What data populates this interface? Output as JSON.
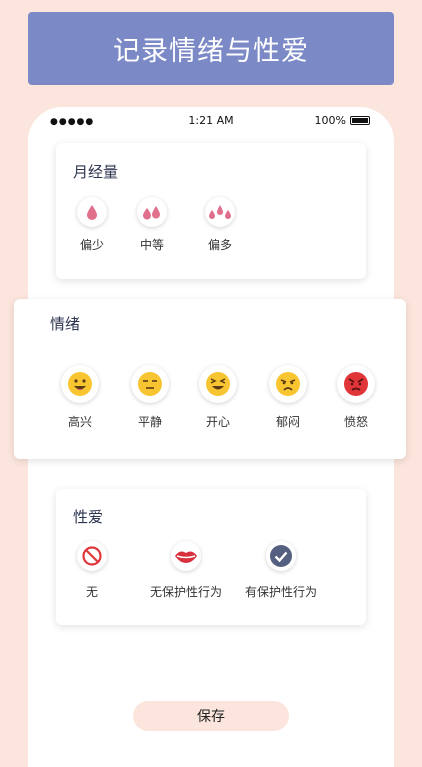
{
  "banner": {
    "title": "记录情绪与性爱"
  },
  "status_bar": {
    "time": "1:21 AM",
    "battery": "100%"
  },
  "flow": {
    "title": "月经量",
    "options": [
      {
        "label": "偏少",
        "icon": "one-drop-icon"
      },
      {
        "label": "中等",
        "icon": "two-drops-icon"
      },
      {
        "label": "偏多",
        "icon": "three-drops-icon"
      }
    ]
  },
  "mood": {
    "title": "情绪",
    "options": [
      {
        "label": "高兴",
        "icon": "happy-face-icon"
      },
      {
        "label": "平静",
        "icon": "calm-face-icon"
      },
      {
        "label": "开心",
        "icon": "laughing-face-icon"
      },
      {
        "label": "郁闷",
        "icon": "gloomy-face-icon"
      },
      {
        "label": "愤怒",
        "icon": "angry-face-icon"
      }
    ]
  },
  "sex": {
    "title": "性爱",
    "options": [
      {
        "label": "无",
        "icon": "prohibited-icon"
      },
      {
        "label": "无保护性行为",
        "icon": "lips-icon"
      },
      {
        "label": "有保护性行为",
        "icon": "check-circle-icon"
      }
    ]
  },
  "save_button": {
    "label": "保存"
  },
  "colors": {
    "accent": "#7b8ac7",
    "background": "#fbe5dc",
    "drop": "#e0708c"
  }
}
